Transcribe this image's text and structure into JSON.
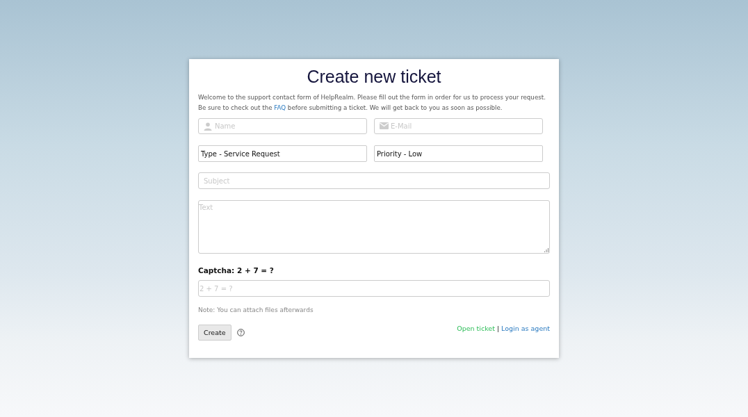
{
  "title": "Create new ticket",
  "intro": {
    "before": "Welcome to the support contact form of HelpRealm. Please fill out the form in order for us to process your request. Be sure to check out the ",
    "link": "FAQ",
    "after": " before submitting a ticket. We will get back to you as soon as possible."
  },
  "contact_fields": [
    {
      "kind": "person",
      "placeholder": "Name"
    },
    {
      "kind": "mail",
      "placeholder": "E-Mail"
    }
  ],
  "selects": [
    {
      "value": "Type - Service Request"
    },
    {
      "value": "Priority - Low"
    }
  ],
  "subject": {
    "placeholder": "Subject"
  },
  "text": {
    "placeholder": "Text"
  },
  "captcha": {
    "label": "Captcha: 2 + 7 = ?",
    "placeholder": "2 + 7 = ?"
  },
  "note": "Note: You can attach files afterwards",
  "create_button": "Create",
  "links": {
    "open_ticket": "Open ticket",
    "separator": "|",
    "login": "Login as agent"
  }
}
